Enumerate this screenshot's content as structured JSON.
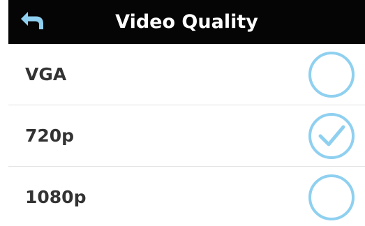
{
  "header": {
    "title": "Video Quality",
    "back_icon": "back-arrow-icon"
  },
  "options": [
    {
      "label": "VGA",
      "selected": false
    },
    {
      "label": "720p",
      "selected": true
    },
    {
      "label": "1080p",
      "selected": false
    }
  ],
  "colors": {
    "header_bg": "#050505",
    "header_text": "#ffffff",
    "accent": "#8fd0f0",
    "label_text": "#333333",
    "divider": "#e2e2e2"
  }
}
